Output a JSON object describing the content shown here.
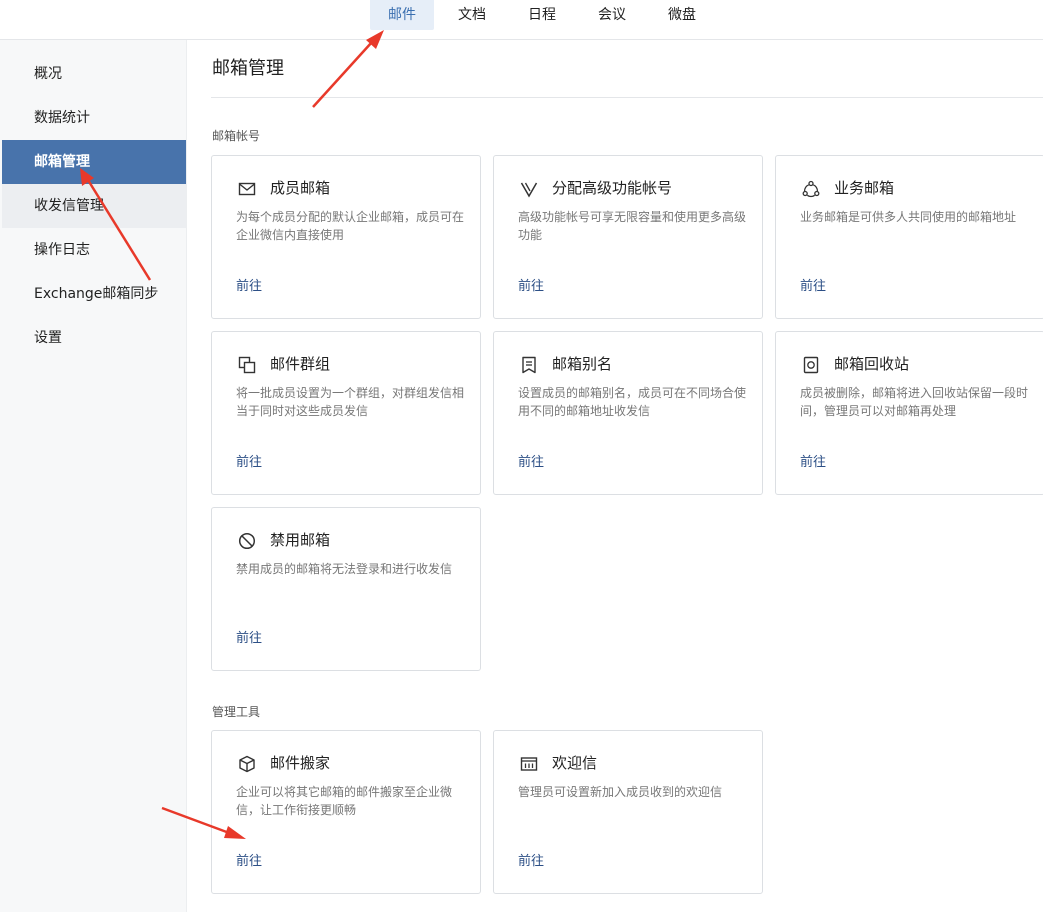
{
  "topnav": {
    "tabs": [
      {
        "label": "邮件",
        "active": true
      },
      {
        "label": "文档"
      },
      {
        "label": "日程"
      },
      {
        "label": "会议"
      },
      {
        "label": "微盘"
      }
    ]
  },
  "sidebar": {
    "items": [
      {
        "label": "概况"
      },
      {
        "label": "数据统计"
      },
      {
        "label": "邮箱管理",
        "active": true
      },
      {
        "label": "收发信管理"
      },
      {
        "label": "操作日志"
      },
      {
        "label": "Exchange邮箱同步"
      },
      {
        "label": "设置"
      }
    ]
  },
  "main": {
    "title": "邮箱管理",
    "sections": [
      {
        "label": "邮箱帐号",
        "cards": [
          {
            "icon": "mail-icon",
            "title": "成员邮箱",
            "desc": "为每个成员分配的默认企业邮箱，成员可在企业微信内直接使用",
            "link": "前往"
          },
          {
            "icon": "v-icon",
            "title": "分配高级功能帐号",
            "desc": "高级功能帐号可享无限容量和使用更多高级功能",
            "link": "前往"
          },
          {
            "icon": "shared-icon",
            "title": "业务邮箱",
            "desc": "业务邮箱是可供多人共同使用的邮箱地址",
            "link": "前往"
          },
          {
            "icon": "group-icon",
            "title": "邮件群组",
            "desc": "将一批成员设置为一个群组，对群组发信相当于同时对这些成员发信",
            "link": "前往"
          },
          {
            "icon": "alias-icon",
            "title": "邮箱别名",
            "desc": "设置成员的邮箱别名，成员可在不同场合使用不同的邮箱地址收发信",
            "link": "前往"
          },
          {
            "icon": "recycle-icon",
            "title": "邮箱回收站",
            "desc": "成员被删除，邮箱将进入回收站保留一段时间，管理员可以对邮箱再处理",
            "link": "前往"
          },
          {
            "icon": "ban-icon",
            "title": "禁用邮箱",
            "desc": "禁用成员的邮箱将无法登录和进行收发信",
            "link": "前往"
          }
        ]
      },
      {
        "label": "管理工具",
        "cards": [
          {
            "icon": "box-icon",
            "title": "邮件搬家",
            "desc": "企业可以将其它邮箱的邮件搬家至企业微信，让工作衔接更顺畅",
            "link": "前往"
          },
          {
            "icon": "welcome-icon",
            "title": "欢迎信",
            "desc": "管理员可设置新加入成员收到的欢迎信",
            "link": "前往"
          }
        ]
      }
    ]
  },
  "colors": {
    "accent": "#4873ab",
    "link": "#2c4f86",
    "annotation": "#e8392a"
  }
}
